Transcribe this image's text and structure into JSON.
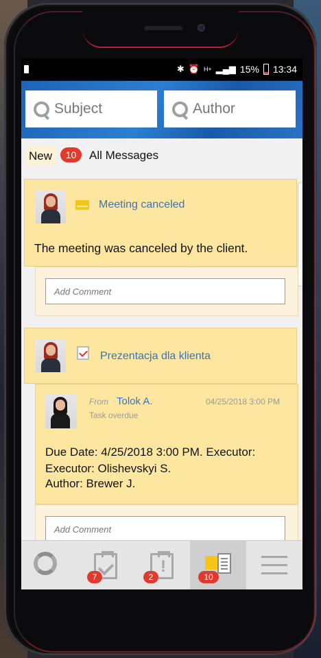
{
  "status": {
    "signal_label": "H+",
    "battery_percent": "15%",
    "time": "13:34"
  },
  "search": {
    "subject_placeholder": "Subject",
    "author_placeholder": "Author"
  },
  "filter": {
    "new_label": "New",
    "new_count": "10",
    "all_label": "All Messages"
  },
  "message1": {
    "title": "Meeting canceled",
    "body": "The meeting was canceled by the client.",
    "comment_placeholder": "Add Comment"
  },
  "message2": {
    "title": "Prezentacja dla klienta",
    "from_label": "From",
    "from_name": "Tolok A.",
    "date": "04/25/2018 3:00 PM",
    "status": "Task overdue",
    "line1": "Due Date: 4/25/2018 3:00 PM. Executor:",
    "line2": "Executor: Olishevskyi S.",
    "line3": "Author: Brewer J.",
    "comment_placeholder": "Add Comment"
  },
  "tabs": {
    "tasks_count": "7",
    "alerts_count": "2",
    "messages_count": "10"
  },
  "colors": {
    "accent_blue": "#1e63b8",
    "card_yellow": "#fde7a0",
    "badge_red": "#e03a2e",
    "link_blue": "#3b73b8"
  }
}
